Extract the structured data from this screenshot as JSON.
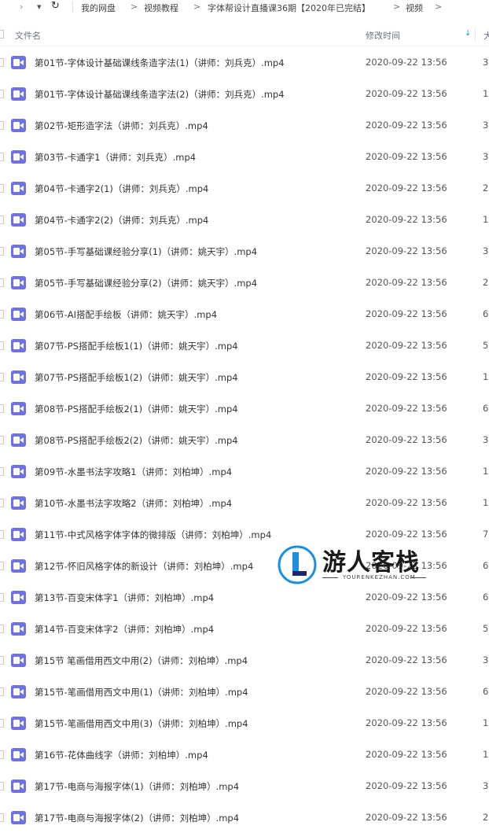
{
  "breadcrumb": {
    "items": [
      "我的网盘",
      "视频教程",
      "字体帮设计直播课36期【2020年已完结】",
      "视频"
    ],
    "separator": ">"
  },
  "toolbar": {
    "nav_chevron": "›",
    "dropdown": "▾",
    "refresh": "↻"
  },
  "header": {
    "name_col": "文件名",
    "time_col": "修改时间",
    "size_col": "大",
    "sort_arrow": "↓"
  },
  "files": [
    {
      "name": "第01节-字体设计基础课线条造字法(1)（讲师：刘兵克）.mp4",
      "date": "2020-09-22 13:56",
      "size": "3"
    },
    {
      "name": "第01节-字体设计基础课线条造字法(2)（讲师：刘兵克）.mp4",
      "date": "2020-09-22 13:56",
      "size": "1"
    },
    {
      "name": "第02节-矩形造字法（讲师：刘兵克）.mp4",
      "date": "2020-09-22 13:56",
      "size": "3"
    },
    {
      "name": "第03节-卡通字1（讲师：刘兵克）.mp4",
      "date": "2020-09-22 13:56",
      "size": "3"
    },
    {
      "name": "第04节-卡通字2(1)（讲师：刘兵克）.mp4",
      "date": "2020-09-22 13:56",
      "size": "2"
    },
    {
      "name": "第04节-卡通字2(2)（讲师：刘兵克）.mp4",
      "date": "2020-09-22 13:56",
      "size": "1"
    },
    {
      "name": "第05节-手写基础课经验分享(1)（讲师：姚天宇）.mp4",
      "date": "2020-09-22 13:56",
      "size": "3"
    },
    {
      "name": "第05节-手写基础课经验分享(2)（讲师：姚天宇）.mp4",
      "date": "2020-09-22 13:56",
      "size": "2"
    },
    {
      "name": "第06节-AI搭配手绘板（讲师：姚天宇）.mp4",
      "date": "2020-09-22 13:56",
      "size": "6"
    },
    {
      "name": "第07节-PS搭配手绘板1(1)（讲师：姚天宇）.mp4",
      "date": "2020-09-22 13:56",
      "size": "5"
    },
    {
      "name": "第07节-PS搭配手绘板1(2)（讲师：姚天宇）.mp4",
      "date": "2020-09-22 13:56",
      "size": "1"
    },
    {
      "name": "第08节-PS搭配手绘板2(1)（讲师：姚天宇）.mp4",
      "date": "2020-09-22 13:56",
      "size": "6"
    },
    {
      "name": "第08节-PS搭配手绘板2(2)（讲师：姚天宇）.mp4",
      "date": "2020-09-22 13:56",
      "size": "3"
    },
    {
      "name": "第09节-水墨书法字攻略1（讲师：刘柏坤）.mp4",
      "date": "2020-09-22 13:56",
      "size": "1"
    },
    {
      "name": "第10节-水墨书法字攻略2（讲师：刘柏坤）.mp4",
      "date": "2020-09-22 13:56",
      "size": "1"
    },
    {
      "name": "第11节-中式风格字体字体的微排版（讲师：刘柏坤）.mp4",
      "date": "2020-09-22 13:56",
      "size": "7"
    },
    {
      "name": "第12节-怀旧风格字体的新设计（讲师：刘柏坤）.mp4",
      "date": "2020-09-22 13:56",
      "size": "6"
    },
    {
      "name": "第13节-百变宋体字1（讲师：刘柏坤）.mp4",
      "date": "2020-09-22 13:56",
      "size": "6"
    },
    {
      "name": "第14节-百变宋体字2（讲师：刘柏坤）.mp4",
      "date": "2020-09-22 13:56",
      "size": "5"
    },
    {
      "name": "第15节 笔画借用西文中用(2)（讲师：刘柏坤）.mp4",
      "date": "2020-09-22 13:56",
      "size": "3"
    },
    {
      "name": "第15节-笔画借用西文中用(1)（讲师：刘柏坤）.mp4",
      "date": "2020-09-22 13:56",
      "size": "6"
    },
    {
      "name": "第15节-笔画借用西文中用(3)（讲师：刘柏坤）.mp4",
      "date": "2020-09-22 13:56",
      "size": "1"
    },
    {
      "name": "第16节-花体曲线字（讲师：刘柏坤）.mp4",
      "date": "2020-09-22 13:56",
      "size": "1"
    },
    {
      "name": "第17节-电商与海报字体(1)（讲师：刘柏坤）.mp4",
      "date": "2020-09-22 13:56",
      "size": "3"
    },
    {
      "name": "第17节-电商与海报字体(2)（讲师：刘柏坤）.mp4",
      "date": "2020-09-22 13:56",
      "size": "2"
    }
  ],
  "watermark": {
    "title": "游人客栈",
    "url": "YOURENKEZHAN.COM"
  },
  "colors": {
    "file_icon": "#6f6fe6",
    "sort_accent": "#2b8ae6"
  }
}
